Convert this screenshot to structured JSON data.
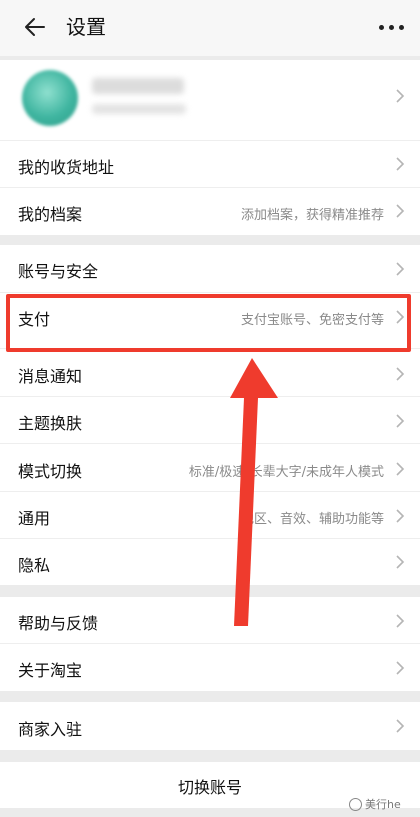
{
  "header": {
    "title": "设置"
  },
  "profile": {},
  "rows": [
    {
      "label": "我的收货地址",
      "hint": ""
    },
    {
      "label": "我的档案",
      "hint": "添加档案，获得精准推荐"
    },
    {
      "label": "账号与安全",
      "hint": ""
    },
    {
      "label": "支付",
      "hint": "支付宝账号、免密支付等"
    },
    {
      "label": "消息通知",
      "hint": ""
    },
    {
      "label": "主题换肤",
      "hint": ""
    },
    {
      "label": "模式切换",
      "hint": "标准/极速/长辈大字/未成年人模式"
    },
    {
      "label": "通用",
      "hint": "地区、音效、辅助功能等"
    },
    {
      "label": "隐私",
      "hint": ""
    },
    {
      "label": "帮助与反馈",
      "hint": ""
    },
    {
      "label": "关于淘宝",
      "hint": ""
    },
    {
      "label": "商家入驻",
      "hint": ""
    }
  ],
  "footer": {
    "switch_account": "切换账号",
    "watermark": "美行he"
  },
  "colors": {
    "highlight": "#ef3b2d",
    "arrow": "#ef3b2d",
    "hint_text": "#8a8a8a"
  }
}
